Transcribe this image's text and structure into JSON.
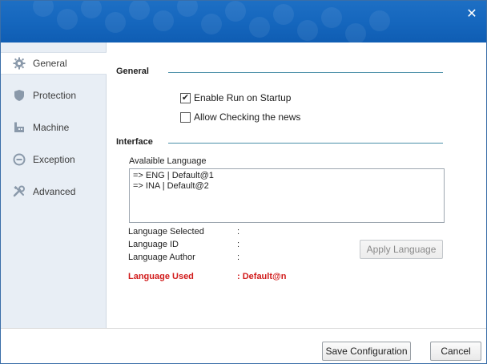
{
  "window": {
    "close_glyph": "✕"
  },
  "sidebar": {
    "items": [
      {
        "label": "General",
        "icon": "gear-icon",
        "active": true
      },
      {
        "label": "Protection",
        "icon": "shield-icon",
        "active": false
      },
      {
        "label": "Machine",
        "icon": "machine-icon",
        "active": false
      },
      {
        "label": "Exception",
        "icon": "minus-circle-icon",
        "active": false
      },
      {
        "label": "Advanced",
        "icon": "tools-icon",
        "active": false
      }
    ]
  },
  "general": {
    "title": "General",
    "enable_run_on_startup": {
      "label": "Enable Run on Startup",
      "checked": true
    },
    "allow_checking_news": {
      "label": "Allow Checking the news",
      "checked": false
    }
  },
  "interface": {
    "title": "Interface",
    "available_language_label": "Avalaible Language",
    "languages": [
      "=> ENG | Default@1",
      "=> INA | Default@2"
    ],
    "language_selected_label": "Language Selected",
    "language_id_label": "Language ID",
    "language_author_label": "Language Author",
    "colon": ":",
    "apply_language_label": "Apply Language",
    "language_used_label": "Language Used",
    "language_used_value": ": Default@n"
  },
  "footer": {
    "save_label": "Save Configuration",
    "cancel_label": "Cancel"
  },
  "colors": {
    "accent": "#1566bd",
    "used_text": "#d11a1a",
    "section_line": "#4a8fa8"
  }
}
